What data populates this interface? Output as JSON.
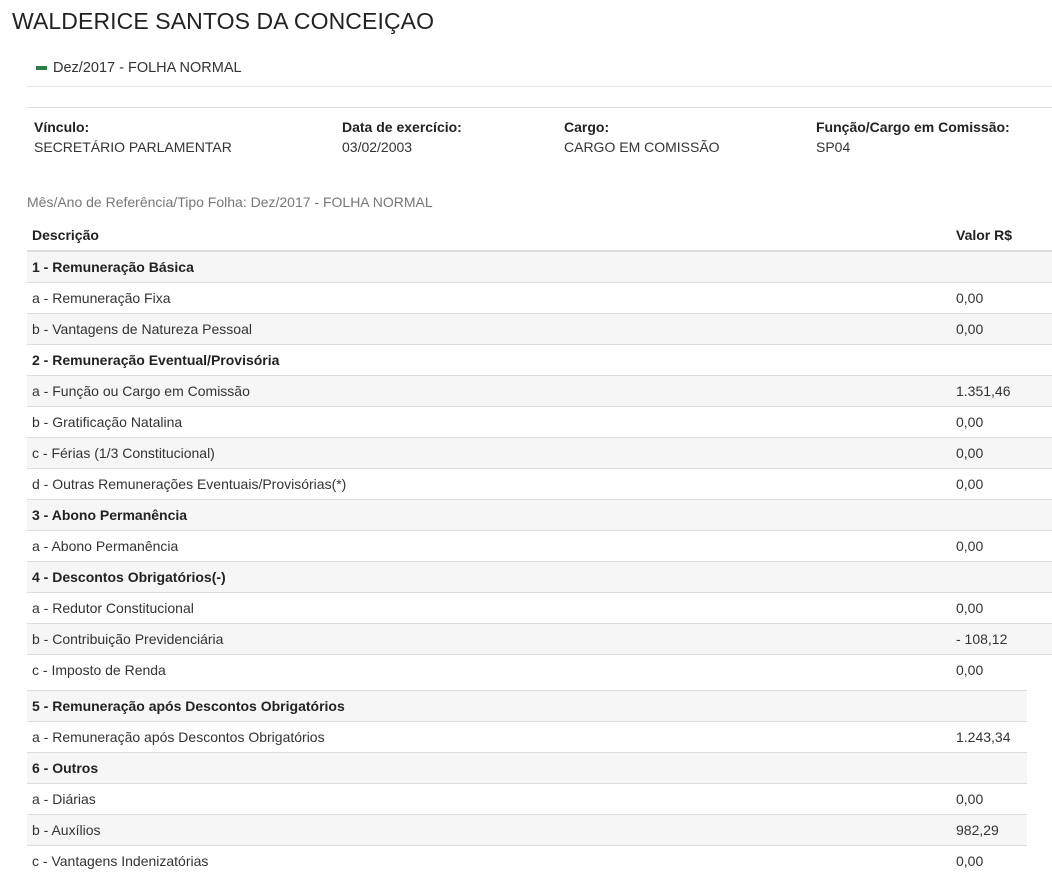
{
  "person": {
    "name": "WALDERICE SANTOS DA CONCEIÇAO"
  },
  "period": {
    "label": "Dez/2017 - FOLHA NORMAL"
  },
  "info": [
    {
      "label": "Vínculo:",
      "value": "SECRETÁRIO PARLAMENTAR"
    },
    {
      "label": "Data de exercício:",
      "value": "03/02/2003"
    },
    {
      "label": "Cargo:",
      "value": "CARGO EM COMISSÃO"
    },
    {
      "label": "Função/Cargo em Comissão:",
      "value": "SP04"
    }
  ],
  "reference": {
    "text": "Mês/Ano de Referência/Tipo Folha: Dez/2017 - FOLHA NORMAL"
  },
  "table": {
    "headers": {
      "description": "Descrição",
      "value": "Valor R$"
    },
    "rows": [
      {
        "desc": "1 - Remuneração Básica",
        "value": "",
        "section": true
      },
      {
        "desc": "a - Remuneração Fixa",
        "value": "0,00"
      },
      {
        "desc": "b - Vantagens de Natureza Pessoal",
        "value": "0,00"
      },
      {
        "desc": "2 - Remuneração Eventual/Provisória",
        "value": "",
        "section": true
      },
      {
        "desc": "a - Função ou Cargo em Comissão",
        "value": "1.351,46"
      },
      {
        "desc": "b - Gratificação Natalina",
        "value": "0,00"
      },
      {
        "desc": "c - Férias (1/3 Constitucional)",
        "value": "0,00"
      },
      {
        "desc": "d - Outras Remunerações Eventuais/Provisórias(*)",
        "value": "0,00"
      },
      {
        "desc": "3 - Abono Permanência",
        "value": "",
        "section": true
      },
      {
        "desc": "a - Abono Permanência",
        "value": "0,00"
      },
      {
        "desc": "4 - Descontos Obrigatórios(-)",
        "value": "",
        "section": true
      },
      {
        "desc": "a - Redutor Constitucional",
        "value": "0,00"
      },
      {
        "desc": "b - Contribuição Previdenciária",
        "value": "- 108,12"
      },
      {
        "desc": "c - Imposto de Renda",
        "value": "0,00"
      }
    ],
    "rows2": [
      {
        "desc": "5 - Remuneração após Descontos Obrigatórios",
        "value": "",
        "section": true
      },
      {
        "desc": "a - Remuneração após Descontos Obrigatórios",
        "value": "1.243,34"
      },
      {
        "desc": "6 - Outros",
        "value": "",
        "section": true
      },
      {
        "desc": "a - Diárias",
        "value": "0,00"
      },
      {
        "desc": "b - Auxílios",
        "value": "982,29"
      },
      {
        "desc": "c - Vantagens Indenizatórias",
        "value": "0,00"
      }
    ]
  }
}
